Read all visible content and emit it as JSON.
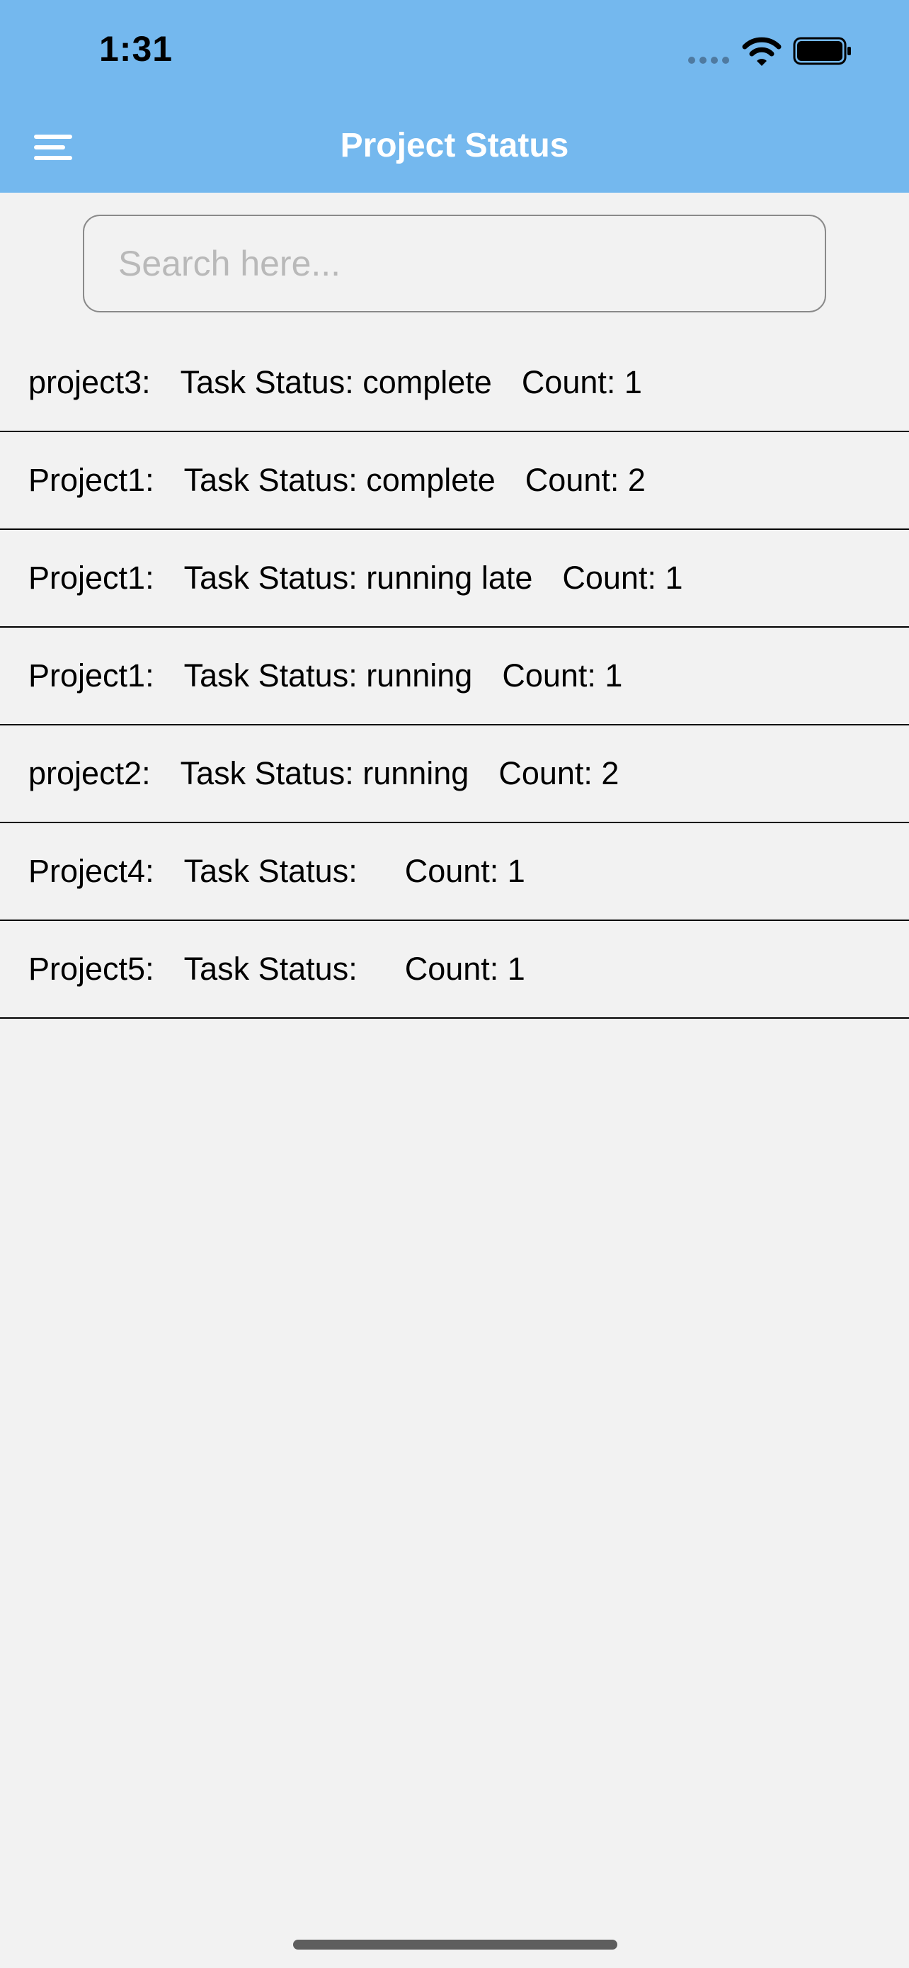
{
  "status_bar": {
    "time": "1:31"
  },
  "header": {
    "title": "Project Status",
    "background_color": "#74b8ee",
    "menu_icon": "hamburger-menu-icon"
  },
  "search": {
    "placeholder": "Search here...",
    "value": ""
  },
  "list": {
    "items": [
      {
        "project": "project3:",
        "status": "Task Status: complete",
        "count": "Count: 1"
      },
      {
        "project": "Project1:",
        "status": "Task Status: complete",
        "count": "Count: 2"
      },
      {
        "project": "Project1:",
        "status": "Task Status: running late",
        "count": "Count: 1"
      },
      {
        "project": "Project1:",
        "status": "Task Status: running",
        "count": "Count: 1"
      },
      {
        "project": "project2:",
        "status": "Task Status: running",
        "count": "Count: 2"
      },
      {
        "project": "Project4:",
        "status": "Task Status:  ",
        "count": "Count: 1"
      },
      {
        "project": "Project5:",
        "status": "Task Status:  ",
        "count": "Count: 1"
      }
    ]
  }
}
